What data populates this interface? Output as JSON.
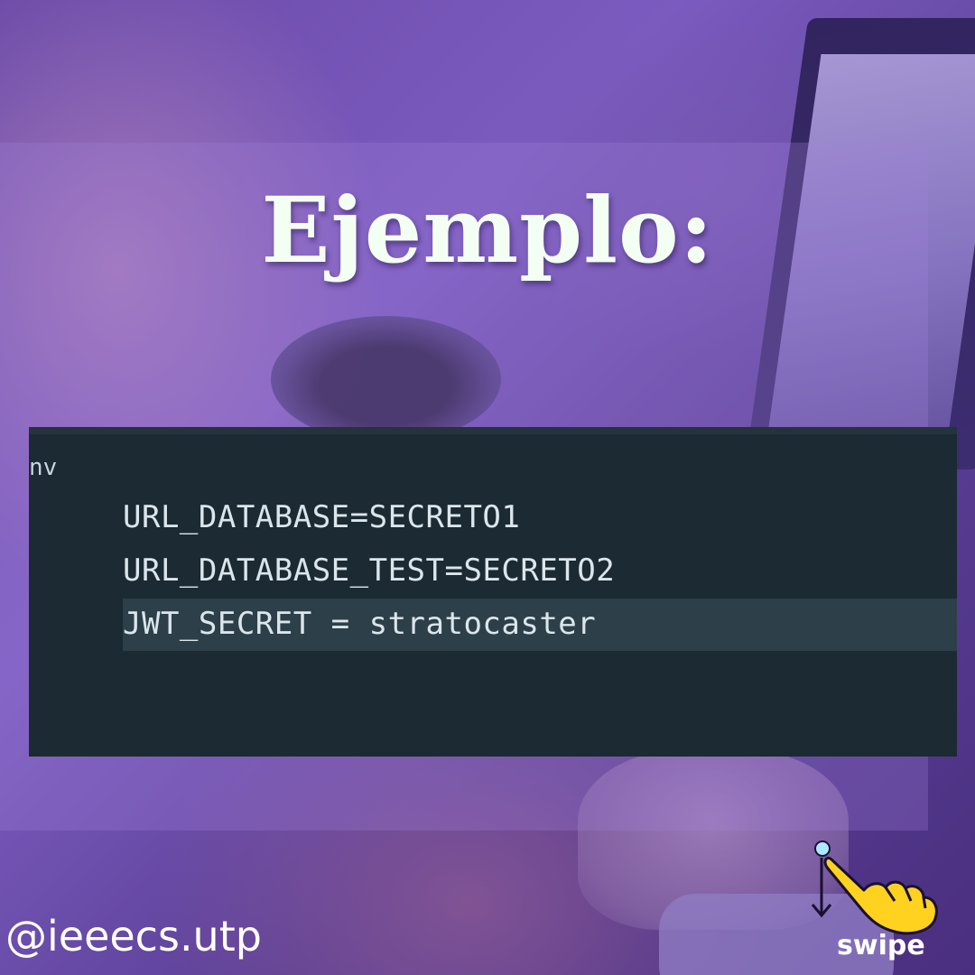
{
  "title": "Ejemplo:",
  "editor": {
    "fragment": "nv",
    "lines": [
      "URL_DATABASE=SECRETO1",
      "URL_DATABASE_TEST=SECRETO2",
      "JWT_SECRET = stratocaster"
    ]
  },
  "handle": "@ieeecs.utp",
  "swipe": {
    "label": "swipe",
    "icon": "pointing-hand-swipe-icon"
  },
  "colors": {
    "background": "#5b3f9a",
    "editor_bg": "#1b2a33",
    "highlight": "#2d3f49",
    "title": "#f4fff4",
    "swipe_hand": "#ffd21f"
  }
}
